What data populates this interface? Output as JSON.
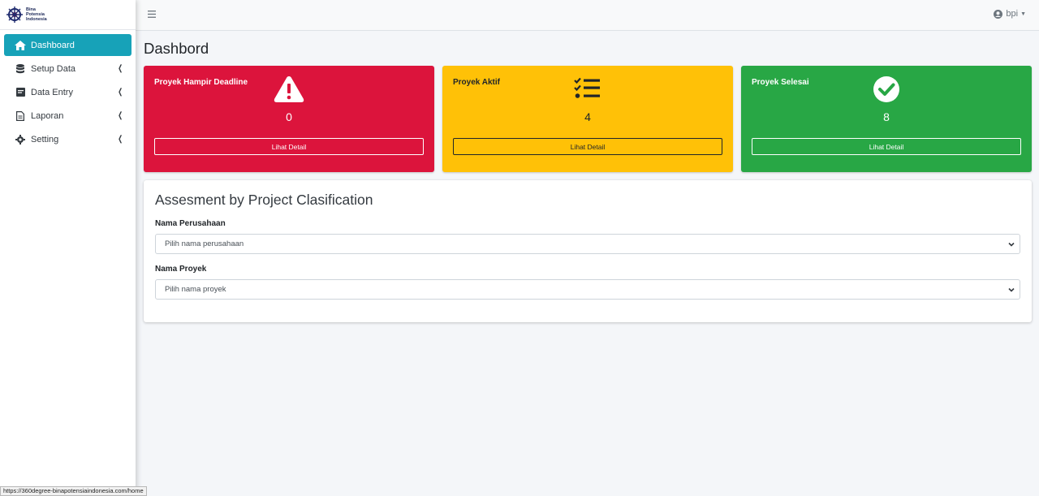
{
  "brand": {
    "line1": "Bina",
    "line2": "Potensia",
    "line3": "Indonesia"
  },
  "sidebar": {
    "items": [
      {
        "label": "Dashboard",
        "icon": "home-icon",
        "active": true
      },
      {
        "label": "Setup Data",
        "icon": "database-icon"
      },
      {
        "label": "Data Entry",
        "icon": "edit-icon"
      },
      {
        "label": "Laporan",
        "icon": "file-icon"
      },
      {
        "label": "Setting",
        "icon": "gear-icon"
      }
    ]
  },
  "topbar": {
    "user": "bpi"
  },
  "page": {
    "title": "Dashbord"
  },
  "boxes": [
    {
      "title": "Proyek Hampir Deadline",
      "value": "0",
      "button": "Lihat Detail",
      "color": "#dc143c",
      "icon": "warning-icon"
    },
    {
      "title": "Proyek Aktif",
      "value": "4",
      "button": "Lihat Detail",
      "color": "#ffc107",
      "icon": "tasks-icon"
    },
    {
      "title": "Proyek Selesai",
      "value": "8",
      "button": "Lihat Detail",
      "color": "#28a745",
      "icon": "check-circle-icon"
    }
  ],
  "assessment": {
    "title": "Assesment by Project Clasification",
    "company_label": "Nama Perusahaan",
    "company_placeholder": "Pilih nama perusahaan",
    "project_label": "Nama Proyek",
    "project_placeholder": "Pilih nama proyek"
  },
  "status_url": "https://360degree-binapotensiaindonesia.com/home",
  "colors": {
    "accent": "#17a2b8",
    "background": "#f4f6f9"
  }
}
